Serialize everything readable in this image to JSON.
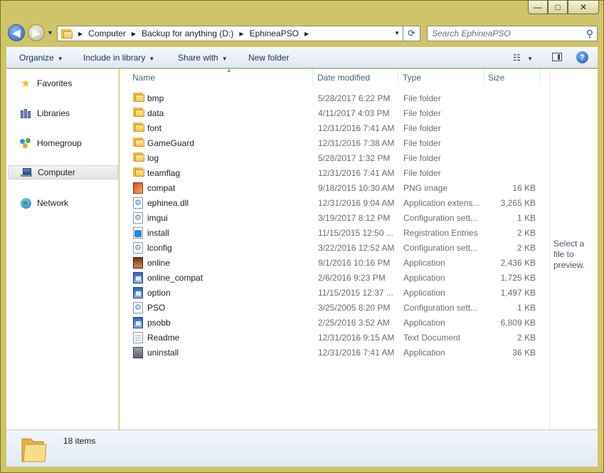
{
  "window": {
    "controls": {
      "minimize": "—",
      "maximize": "□",
      "close": "✕"
    }
  },
  "navigation": {
    "back_icon": "back-arrow-icon",
    "forward_icon": "forward-arrow-icon",
    "breadcrumb": [
      "Computer",
      "Backup for anything (D:)",
      "EphineaPSO"
    ],
    "search_placeholder": "Search EphineaPSO"
  },
  "toolbar": {
    "organize": "Organize",
    "include_in_library": "Include in library",
    "share_with": "Share with",
    "new_folder": "New folder",
    "help": "?"
  },
  "sidebar": {
    "items": [
      {
        "label": "Favorites",
        "icon": "star-icon"
      },
      {
        "label": "Libraries",
        "icon": "libraries-icon"
      },
      {
        "label": "Homegroup",
        "icon": "homegroup-icon"
      },
      {
        "label": "Computer",
        "icon": "computer-icon",
        "selected": true
      },
      {
        "label": "Network",
        "icon": "network-icon"
      }
    ]
  },
  "columns": {
    "name": "Name",
    "date": "Date modified",
    "type": "Type",
    "size": "Size"
  },
  "files": [
    {
      "name": "bmp",
      "date": "5/28/2017 6:22 PM",
      "type": "File folder",
      "size": "",
      "icon": "folder"
    },
    {
      "name": "data",
      "date": "4/11/2017 4:03 PM",
      "type": "File folder",
      "size": "",
      "icon": "folder"
    },
    {
      "name": "font",
      "date": "12/31/2016 7:41 AM",
      "type": "File folder",
      "size": "",
      "icon": "folder"
    },
    {
      "name": "GameGuard",
      "date": "12/31/2016 7:38 AM",
      "type": "File folder",
      "size": "",
      "icon": "folder"
    },
    {
      "name": "log",
      "date": "5/28/2017 1:32 PM",
      "type": "File folder",
      "size": "",
      "icon": "folder"
    },
    {
      "name": "teamflag",
      "date": "12/31/2016 7:41 AM",
      "type": "File folder",
      "size": "",
      "icon": "folder"
    },
    {
      "name": "compat",
      "date": "9/18/2015 10:30 AM",
      "type": "PNG image",
      "size": "16 KB",
      "icon": "png"
    },
    {
      "name": "ephinea.dll",
      "date": "12/31/2016 9:04 AM",
      "type": "Application extens...",
      "size": "3,265 KB",
      "icon": "gear"
    },
    {
      "name": "imgui",
      "date": "3/19/2017 8:12 PM",
      "type": "Configuration sett...",
      "size": "1 KB",
      "icon": "gear"
    },
    {
      "name": "install",
      "date": "11/15/2015 12:50 ...",
      "type": "Registration Entries",
      "size": "2 KB",
      "icon": "reg"
    },
    {
      "name": "lconfig",
      "date": "3/22/2016 12:52 AM",
      "type": "Configuration sett...",
      "size": "2 KB",
      "icon": "gear"
    },
    {
      "name": "online",
      "date": "9/1/2016 10:16 PM",
      "type": "Application",
      "size": "2,436 KB",
      "icon": "face"
    },
    {
      "name": "online_compat",
      "date": "2/6/2016 9:23 PM",
      "type": "Application",
      "size": "1,725 KB",
      "icon": "app"
    },
    {
      "name": "option",
      "date": "11/15/2015 12:37 ...",
      "type": "Application",
      "size": "1,497 KB",
      "icon": "app"
    },
    {
      "name": "PSO",
      "date": "3/25/2005 8:20 PM",
      "type": "Configuration sett...",
      "size": "1 KB",
      "icon": "gear"
    },
    {
      "name": "psobb",
      "date": "2/25/2016 3:52 AM",
      "type": "Application",
      "size": "6,809 KB",
      "icon": "app"
    },
    {
      "name": "Readme",
      "date": "12/31/2016 9:15 AM",
      "type": "Text Document",
      "size": "2 KB",
      "icon": "txt"
    },
    {
      "name": "uninstall",
      "date": "12/31/2016 7:41 AM",
      "type": "Application",
      "size": "36 KB",
      "icon": "box"
    }
  ],
  "preview": {
    "text": "Select a file to preview."
  },
  "details": {
    "count": "18 items"
  }
}
